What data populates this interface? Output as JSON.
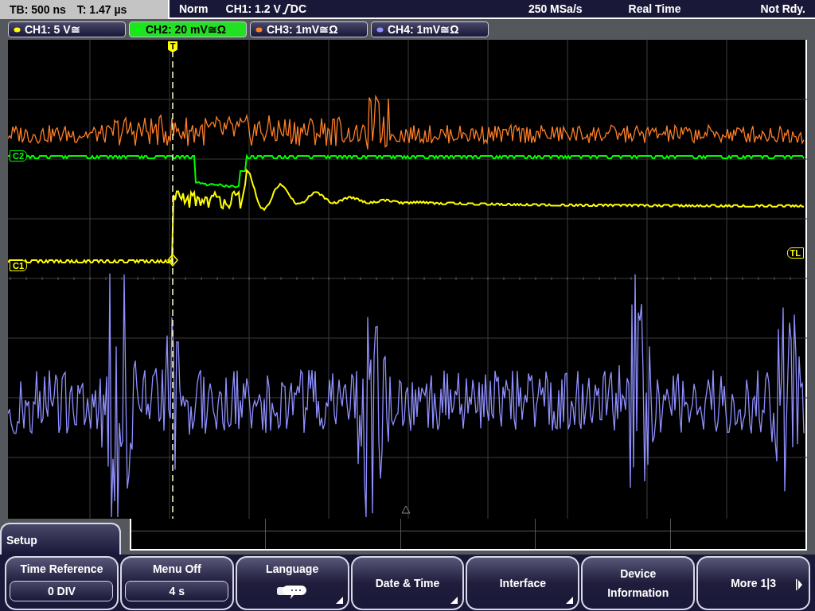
{
  "status_bar": {
    "timebase": "TB: 500 ns",
    "trigger_time": "T: 1.47 µs",
    "trigger_mode": "Norm",
    "trigger_source": "CH1: 1.2 V",
    "trigger_coupling": "DC",
    "sample_rate": "250 MSa/s",
    "acquisition": "Real Time",
    "state": "Not Rdy."
  },
  "channels": [
    {
      "label": "CH1: 5 V≅",
      "color": "#ffff00",
      "selected": false
    },
    {
      "label": "CH2: 20 mV≅Ω",
      "color": "#00ff00",
      "selected": true
    },
    {
      "label": "CH3: 1mV≅Ω",
      "color": "#ff7f27",
      "selected": false
    },
    {
      "label": "CH4: 1mV≅Ω",
      "color": "#8f8fff",
      "selected": false
    }
  ],
  "plot": {
    "trigger_marker": "T",
    "markers": [
      {
        "label": "C2",
        "color": "#00ff00"
      },
      {
        "label": "C1",
        "color": "#ffff00"
      },
      {
        "label": "TL",
        "color": "#ffff00"
      }
    ]
  },
  "menu": {
    "title": "Setup",
    "softkeys": [
      {
        "kind": "value",
        "label": "Time Reference",
        "value": "0 DIV",
        "submenu": false
      },
      {
        "kind": "value",
        "label": "Menu Off",
        "value": "4 s",
        "submenu": false
      },
      {
        "kind": "icon",
        "label": "Language",
        "submenu": true
      },
      {
        "kind": "plain",
        "label": "Date & Time",
        "submenu": true
      },
      {
        "kind": "plain",
        "label": "Interface",
        "submenu": true
      },
      {
        "kind": "plain",
        "label": "Device Information",
        "submenu": false
      },
      {
        "kind": "next",
        "label": "More 1|3",
        "submenu": false
      }
    ]
  }
}
